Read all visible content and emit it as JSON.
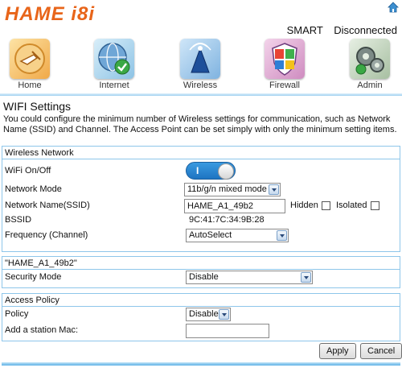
{
  "header": {
    "logo_text": "HAME i8i",
    "mode": "SMART",
    "connection_status": "Disconnected"
  },
  "nav": {
    "items": [
      {
        "label": "Home",
        "icon": "home-hand-icon"
      },
      {
        "label": "Internet",
        "icon": "globe-check-icon"
      },
      {
        "label": "Wireless",
        "icon": "wireless-tower-icon"
      },
      {
        "label": "Firewall",
        "icon": "firewall-shield-icon"
      },
      {
        "label": "Admin",
        "icon": "admin-gears-icon"
      }
    ]
  },
  "page": {
    "title": "WIFI Settings",
    "description": "You could configure the minimum number of Wireless settings for communication, such as Network Name (SSID) and Channel. The Access Point can be set simply with only the minimum setting items."
  },
  "wireless_network": {
    "heading": "Wireless Network",
    "wifi_label": "WiFi On/Off",
    "wifi_toggle_text": "I",
    "mode_label": "Network Mode",
    "mode_value": "11b/g/n mixed mode",
    "ssid_label": "Network Name(SSID)",
    "ssid_value": "HAME_A1_49b2",
    "hidden_label": "Hidden",
    "isolated_label": "Isolated",
    "bssid_label": "BSSID",
    "bssid_value": "9C:41:7C:34:9B:28",
    "frequency_label": "Frequency (Channel)",
    "frequency_value": "AutoSelect"
  },
  "security": {
    "heading": "\"HAME_A1_49b2\"",
    "mode_label": "Security Mode",
    "mode_value": "Disable"
  },
  "access_policy": {
    "heading": "Access Policy",
    "policy_label": "Policy",
    "policy_value": "Disable",
    "mac_label": "Add a station Mac:",
    "mac_value": ""
  },
  "buttons": {
    "apply": "Apply",
    "cancel": "Cancel"
  },
  "colors": {
    "brand_orange": "#e8651a",
    "border_blue": "#8ec6ea",
    "toggle_blue": "#1e74c2"
  }
}
